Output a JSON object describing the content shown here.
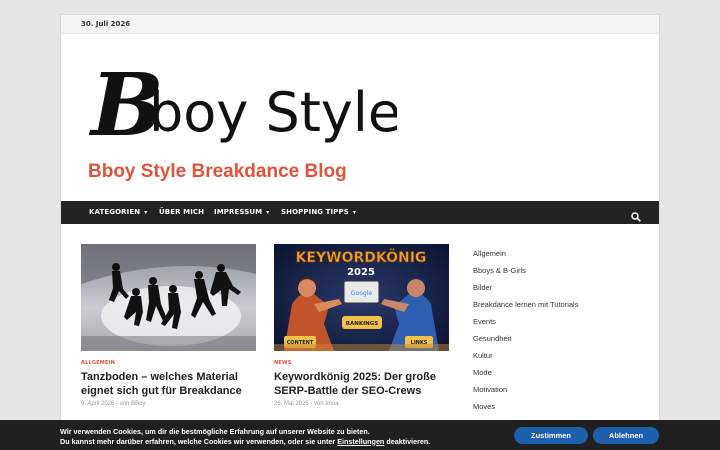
{
  "topbar": {
    "date": "30. Juli 2026"
  },
  "logo": {
    "text_b": "B",
    "text_rest": "boy Style",
    "alt": "Bboy Style logo"
  },
  "site": {
    "title": "Bboy Style Breakdance Blog"
  },
  "nav": {
    "items": [
      {
        "label": "KATEGORIEN",
        "has_dropdown": true
      },
      {
        "label": "ÜBER MICH",
        "has_dropdown": false
      },
      {
        "label": "IMPRESSUM",
        "has_dropdown": true
      },
      {
        "label": "SHOPPING TIPPS",
        "has_dropdown": true
      }
    ],
    "search_icon": "search-icon",
    "caret": "▾"
  },
  "posts": [
    {
      "category": "ALLGEMEIN",
      "title": "Tanzboden – welches Material eignet sich gut für Breakdance",
      "date": "9. April 2026",
      "author_prefix": "von",
      "author": "BBoy",
      "sep": "-"
    },
    {
      "category": "NEWS",
      "title": "Keywordkönig 2025: Der große SERP-Battle der SEO-Crews",
      "date": "26. Mai 2025",
      "author_prefix": "von",
      "author": "khoa",
      "sep": "-",
      "image_text": {
        "headline": "KEYWORDKÖNIG",
        "year": "2025",
        "google": "Google",
        "rankings": "RANKINGS",
        "content": "CONTENT",
        "links": "LINKS"
      }
    }
  ],
  "sidebar": {
    "items": [
      "Allgemein",
      "Bboys & B-Girls",
      "Bilder",
      "Breakdance lernen mit Tutorials",
      "Events",
      "Gesundheit",
      "Kultur",
      "Mode",
      "Motivation",
      "Moves"
    ]
  },
  "cookie": {
    "line1": "Wir verwenden Cookies, um dir die bestmögliche Erfahrung auf unserer Website zu bieten.",
    "line2_a": "Du kannst mehr darüber erfahren, welche Cookies wir verwenden, oder sie unter ",
    "line2_link": "Einstellungen",
    "line2_b": " deaktivieren.",
    "accept": "Zustimmen",
    "decline": "Ablehnen"
  },
  "colors": {
    "accent": "#e0533a",
    "nav_bg": "#222222",
    "cookie_bg": "#202020",
    "button": "#1b5fad"
  }
}
